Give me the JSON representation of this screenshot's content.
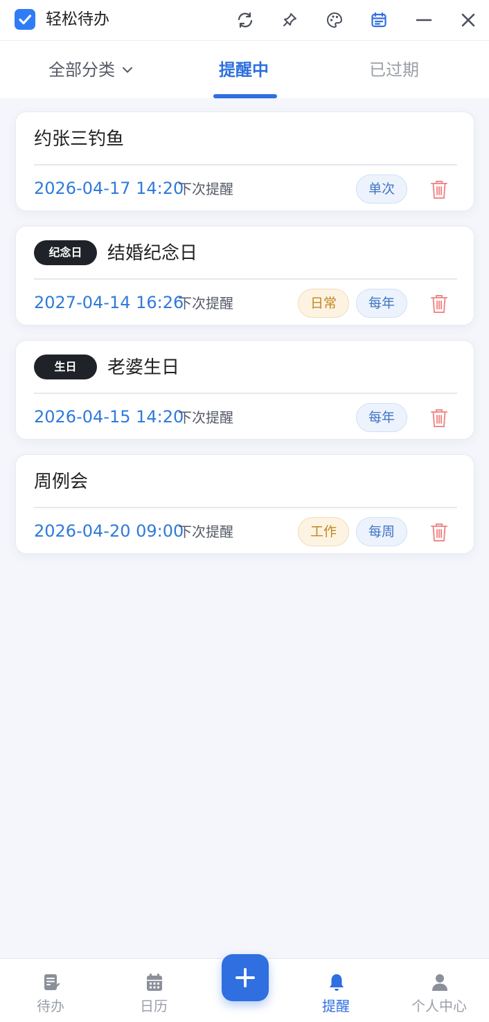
{
  "app": {
    "title": "轻松待办"
  },
  "tabs": {
    "category": "全部分类",
    "active": "提醒中",
    "expired": "已过期"
  },
  "reminders": [
    {
      "title": "约张三钓鱼",
      "badge": "",
      "date": "2026-04-17 14:20",
      "next_label": "下次提醒",
      "category": "",
      "repeat": "单次"
    },
    {
      "title": "结婚纪念日",
      "badge": "纪念日",
      "date": "2027-04-14 16:26",
      "next_label": "下次提醒",
      "category": "日常",
      "repeat": "每年"
    },
    {
      "title": "老婆生日",
      "badge": "生日",
      "date": "2026-04-15 14:20",
      "next_label": "下次提醒",
      "category": "",
      "repeat": "每年"
    },
    {
      "title": "周例会",
      "badge": "",
      "date": "2026-04-20 09:00",
      "next_label": "下次提醒",
      "category": "工作",
      "repeat": "每周"
    }
  ],
  "nav": {
    "todo": "待办",
    "calendar": "日历",
    "reminder": "提醒",
    "profile": "个人中心"
  },
  "colors": {
    "accent": "#2f6fe0",
    "date_blue": "#2f7ad9",
    "trash": "#f08a8a",
    "background": "#f4f6fb"
  }
}
